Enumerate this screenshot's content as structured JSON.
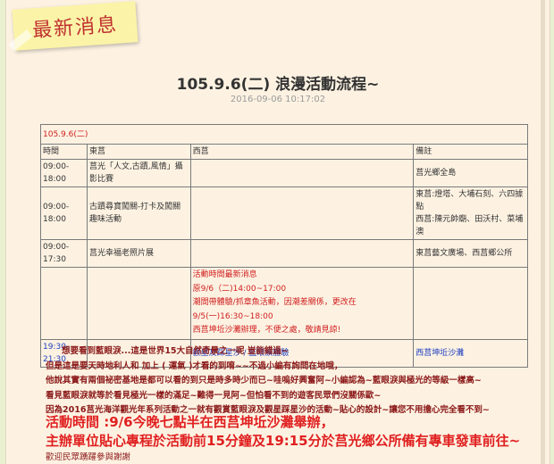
{
  "banner": {
    "label": "最新消息"
  },
  "post": {
    "title": "105.9.6(二) 浪漫活動流程~",
    "datetime": "2016-09-06 10:17:02"
  },
  "schedule": {
    "date_header": "105.9.6(二)",
    "columns": [
      "時間",
      "東莒",
      "西莒",
      "備註"
    ],
    "rows": [
      {
        "time": "09:00-18:00",
        "east": "莒光「人文,古蹟,風情」攝影比賽",
        "west": "",
        "note": "莒光鄉全島"
      },
      {
        "time": "09:00-18:00",
        "east": "古蹟尋寶闖關-打卡及闖關趣味活動",
        "west": "",
        "note_lines": [
          "東莒:燈塔、大埔石刻、六四據",
          "點",
          "西莒:陳元帥廟、田沃村、菜埔",
          "澳"
        ]
      },
      {
        "time": "09:00-17:30",
        "east": "莒光幸福老照片展",
        "west": "",
        "note": "東莒藝文廣場、西莒鄉公所"
      },
      {
        "time": "",
        "east": "",
        "west_lines": [
          "活動時間最新消息",
          "原9/6（二)14:00~17:00",
          "潮間帶體驗/抓章魚活動，因潮差關係，更改在",
          "9/5(一)16:30~18:00",
          "西莒坤坵沙灘辦理，不便之處，敬請見諒!"
        ],
        "note": ""
      },
      {
        "time": "19:30-21:30",
        "east": "",
        "west": "觀星及踩星沙 / 藍眼淚體驗",
        "note": "西莒坤坵沙灘"
      }
    ]
  },
  "intro": {
    "lines": [
      "想要看到藍眼淚...這是世界15大自然奇景之一呢 豈能錯過~",
      "但是這是要天時地利人和 加上 ( 運氣 )才看的到唷~~不過小編有詢問在地哦，",
      "他說其實有兩個祕密基地是都可以看的到只是時多時少而已~哇嗚好興奮阿~小編認為~藍眼淚與極光的等級一樣高~",
      "看見藍眼淚就等於看見極光一樣的滿足~難得一見阿~但怕看不到的遊客民眾們沒關係歐~",
      "因為2016莒光海洋觀光年系列活動之一就有觀賞藍眼淚及觀星踩星沙的活動~貼心的設計~讓您不用擔心完全看不到~"
    ]
  },
  "announce": {
    "line1": "活動時間 :9/6今晚七點半在西莒坤坵沙灘舉辦，",
    "line2": "主辦單位貼心專程於活動前15分鐘及19:15分於莒光鄉公所備有專車發車前往~"
  },
  "footer": {
    "welcome": "歡迎民眾踴躍參與謝謝"
  }
}
